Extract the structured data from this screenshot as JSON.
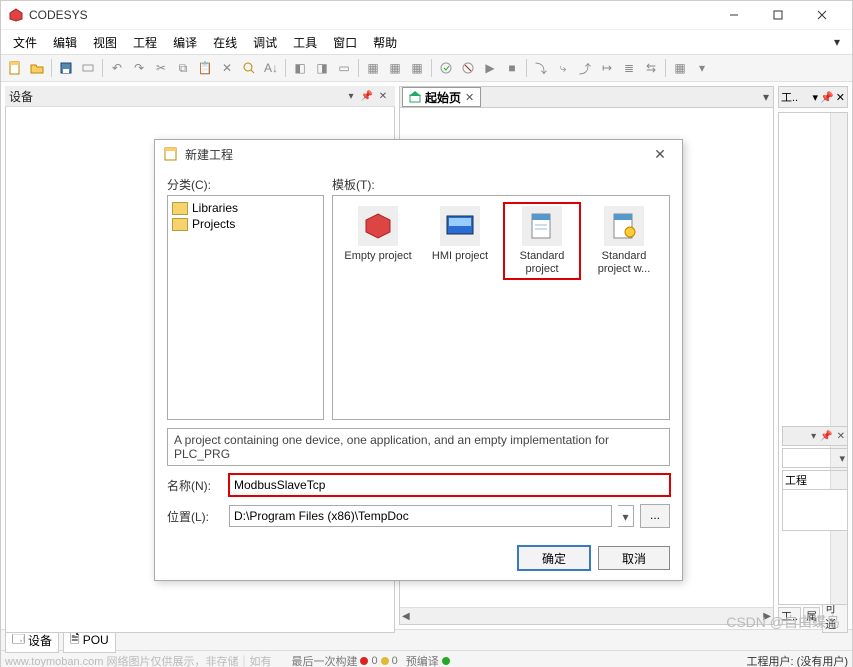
{
  "app": {
    "title": "CODESYS"
  },
  "menu": {
    "items": [
      "文件",
      "编辑",
      "视图",
      "工程",
      "编译",
      "在线",
      "调试",
      "工具",
      "窗口",
      "帮助"
    ]
  },
  "panels": {
    "devices": {
      "title": "设备"
    },
    "startpage": {
      "tab": "起始页"
    },
    "toolbox": {
      "title": "工.."
    },
    "tooltabs": {
      "a": "工..",
      "b": "属",
      "c": "可通"
    },
    "messages": {
      "projcol": "工程"
    }
  },
  "bottomtabs": {
    "devices": "设备",
    "pou": "POU"
  },
  "status": {
    "watermark_note": "www.toymoban.com 网络图片仅供展示，非存储｜如有",
    "lastbuild": "最后一次构建",
    "err": "0",
    "warn": "0",
    "precompile": "预编译",
    "user": "工程用户: (没有用户)"
  },
  "dialog": {
    "title": "新建工程",
    "cat_label": "分类(C):",
    "tmpl_label": "模板(T):",
    "categories": [
      "Libraries",
      "Projects"
    ],
    "templates": [
      {
        "label": "Empty project"
      },
      {
        "label": "HMI project"
      },
      {
        "label": "Standard project"
      },
      {
        "label": "Standard project w..."
      }
    ],
    "desc": "A project containing one device, one application, and an empty implementation for PLC_PRG",
    "name_label": "名称(N):",
    "name_value": "ModbusSlaveTcp",
    "loc_label": "位置(L):",
    "loc_value": "D:\\Program Files (x86)\\TempDoc",
    "ok": "确定",
    "cancel": "取消",
    "browse": "..."
  },
  "watermark": "CSDN @自由蝶鸟"
}
